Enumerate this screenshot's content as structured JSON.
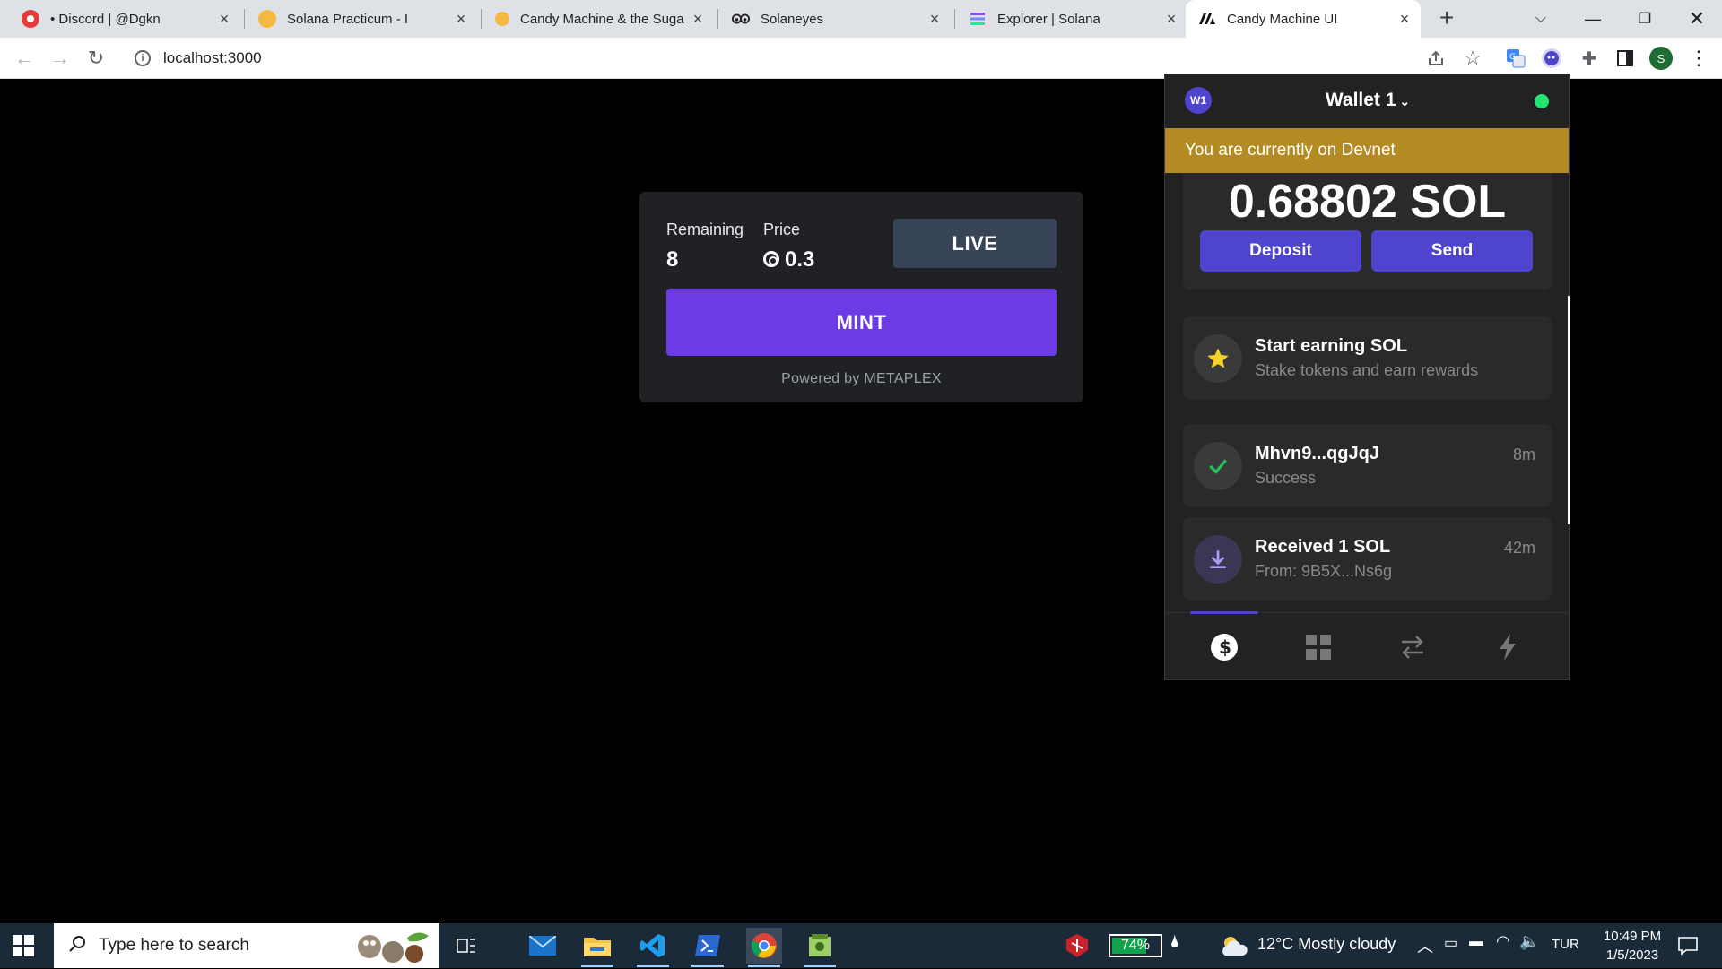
{
  "browser": {
    "tabs": [
      {
        "title": "• Discord | @Dgkn",
        "favicon_color": "#e43a3a"
      },
      {
        "title": "Solana Practicum - I",
        "favicon_color": "#f5b942"
      },
      {
        "title": "Candy Machine & the Suga",
        "favicon_color": "#f5b942"
      },
      {
        "title": "Solaneyes",
        "favicon_color": "#222222"
      },
      {
        "title": "Explorer | Solana",
        "favicon_color": "#8a5cf5"
      },
      {
        "title": "Candy Machine UI",
        "favicon_color": "#111111"
      }
    ],
    "url": "localhost:3000",
    "profile_initial": "S"
  },
  "candy_machine": {
    "remaining_label": "Remaining",
    "remaining_value": "8",
    "price_label": "Price",
    "price_value": "0.3",
    "status_label": "LIVE",
    "mint_label": "MINT",
    "powered_by": "Powered by METAPLEX",
    "accent_color": "#6d3be5"
  },
  "wallet": {
    "avatar": "W1",
    "name": "Wallet 1",
    "network_banner": "You are currently on Devnet",
    "balance": "0.68802 SOL",
    "deposit_label": "Deposit",
    "send_label": "Send",
    "items": [
      {
        "title": "Start earning SOL",
        "subtitle": "Stake tokens and earn rewards",
        "time": "",
        "icon": "star-icon"
      },
      {
        "title": "Mhvn9...qgJqJ",
        "subtitle": "Success",
        "time": "8m",
        "icon": "check-icon"
      },
      {
        "title": "Received 1 SOL",
        "subtitle": "From: 9B5X...Ns6g",
        "time": "42m",
        "icon": "download-icon"
      }
    ],
    "accent_color": "#4e44ce",
    "banner_color": "#b48a23"
  },
  "taskbar": {
    "search_placeholder": "Type here to search",
    "battery": "74%",
    "weather": "12°C  Mostly cloudy",
    "language": "TUR",
    "time": "10:49 PM",
    "date": "1/5/2023"
  }
}
